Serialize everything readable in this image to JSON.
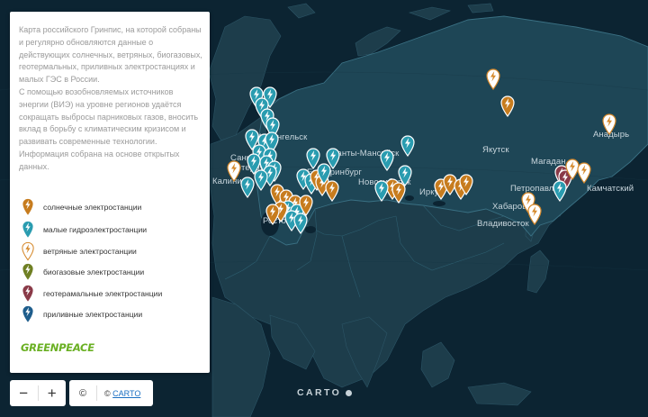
{
  "panel": {
    "intro_paragraphs": [
      "Карта российского Гринпис, на которой собраны и регулярно обновляются данные о действующих солнечных, ветряных, биогазовых, геотермальных, приливных электростанциях и малых ГЭС в России.",
      "С помощью возобновляемых источников энергии (ВИЭ) на уровне регионов удаётся сокращать выбросы парниковых газов, вносить вклад в борьбу с климатическим кризисом и развивать современные технологии. Информация собрана на основе открытых данных."
    ],
    "legend": [
      {
        "label": "солнечные электростанции",
        "color": "#c77c1e",
        "style": "filled",
        "icon": "lightning-icon"
      },
      {
        "label": "малые гидроэлектростанции",
        "color": "#2a9cb0",
        "style": "filled",
        "icon": "lightning-icon"
      },
      {
        "label": "ветряные электростанции",
        "color": "#d5882a",
        "style": "outline",
        "icon": "lightning-icon"
      },
      {
        "label": "биогазовые электростанции",
        "color": "#6f7f23",
        "style": "filled",
        "icon": "lightning-icon"
      },
      {
        "label": "геотерамальные электростанции",
        "color": "#8a3a48",
        "style": "filled",
        "icon": "lightning-icon"
      },
      {
        "label": "приливные электростанции",
        "color": "#1e5d8c",
        "style": "filled",
        "icon": "lightning-icon"
      }
    ],
    "logo_text": "GREENPEACE"
  },
  "zoom": {
    "minus": "−",
    "plus": "+"
  },
  "attribution": {
    "copyright": "©",
    "link_prefix": "©",
    "link_text": "CARTO"
  },
  "watermark": "CARTO",
  "cities": [
    "Архангельск",
    "Санкт-Петербург",
    "Калининград",
    "Ханты-Мансийск",
    "Екатеринбург",
    "Новосибирск",
    "Иркутск",
    "Якутск",
    "Магадан",
    "Анадырь",
    "Петропавловск-Камчатский",
    "Хабаровск",
    "Владивосток",
    "Ростов-на-Дону"
  ],
  "city_labels_shown": [
    "Архангельск",
    "Санкт-",
    "Петербург",
    "Калинин",
    "Ханты-Мансийск",
    "Екатеринбург",
    "Новосибирск",
    "Ирку",
    "Якутск",
    "Магадан",
    "Анадырь",
    "Петропавло",
    "Камчатский",
    "Хабаровск",
    "Владивосток",
    "Росто"
  ],
  "marker_types": {
    "solar": {
      "color": "#c77c1e",
      "style": "filled"
    },
    "hydro": {
      "color": "#2a9cb0",
      "style": "filled"
    },
    "wind": {
      "color": "#d5882a",
      "style": "outline"
    },
    "biogas": {
      "color": "#6f7f23",
      "style": "filled"
    },
    "geothermal": {
      "color": "#8a3a48",
      "style": "filled"
    },
    "tidal": {
      "color": "#1e5d8c",
      "style": "filled"
    }
  }
}
